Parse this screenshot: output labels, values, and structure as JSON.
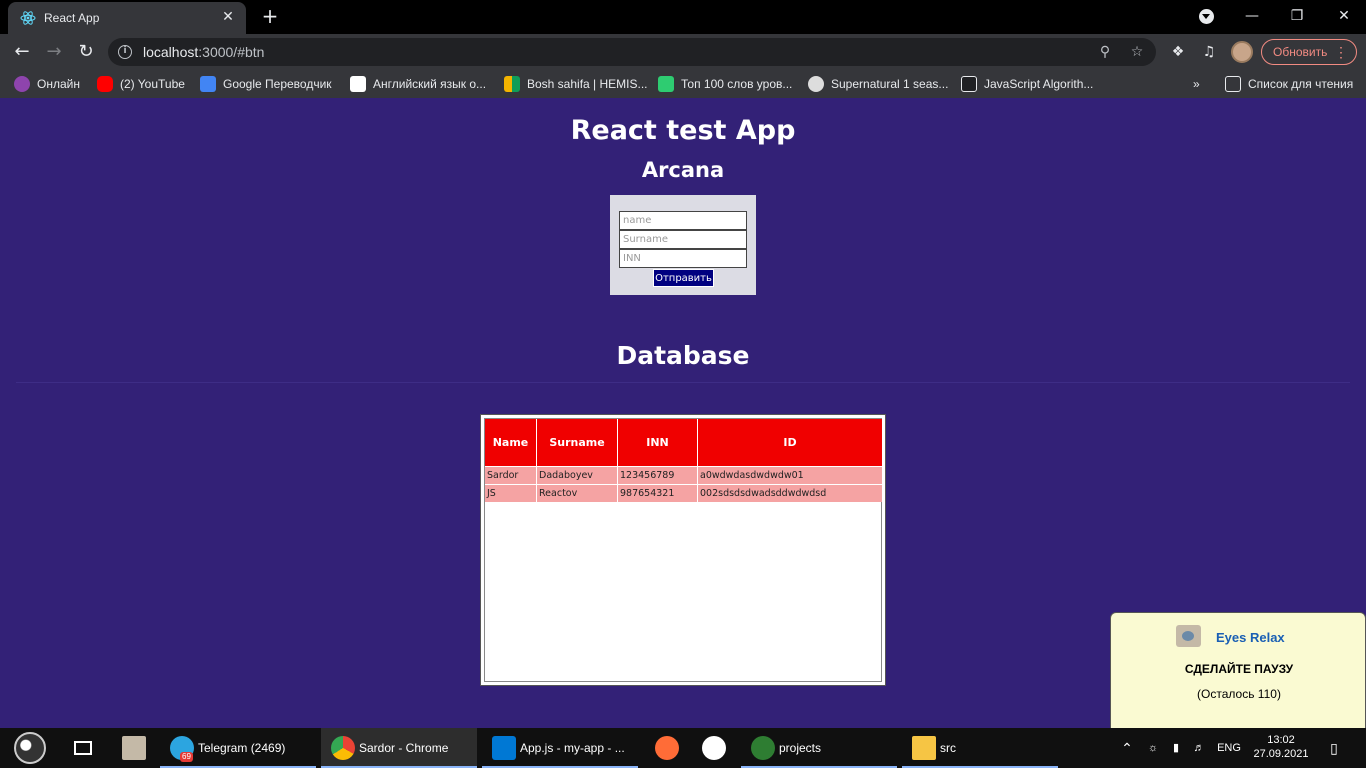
{
  "browser": {
    "tab_title": "React App",
    "url_host": "localhost",
    "url_rest": ":3000/#btn",
    "update_label": "Обновить",
    "bookmarks": [
      {
        "label": "Онлайн",
        "color": "#8e44ad"
      },
      {
        "label": "(2) YouTube",
        "color": "#ff0000"
      },
      {
        "label": "Google Переводчик",
        "color": "#4285f4"
      },
      {
        "label": "Английский язык о...",
        "color": "#ffffff"
      },
      {
        "label": "Bosh sahifa | HEMIS...",
        "color": "#f4b400"
      },
      {
        "label": "Топ 100 слов уров...",
        "color": "#2ecc71"
      },
      {
        "label": "Supernatural 1 seas...",
        "color": "#dddddd"
      },
      {
        "label": "JavaScript Algorith...",
        "color": "#202124"
      }
    ],
    "reading_list": "Список для чтения"
  },
  "page": {
    "title": "React test App",
    "subtitle": "Arcana",
    "form": {
      "name_placeholder": "name",
      "surname_placeholder": "Surname",
      "inn_placeholder": "INN",
      "submit_label": "Отправить"
    },
    "db_title": "Database",
    "table": {
      "headers": [
        "Name",
        "Surname",
        "INN",
        "ID"
      ],
      "rows": [
        [
          "Sardor",
          "Dadaboyev",
          "123456789",
          "a0wdwdasdwdwdw01"
        ],
        [
          "JS",
          "Reactov",
          "987654321",
          "002sdsdsdwadsddwdwdsd"
        ]
      ]
    }
  },
  "notification": {
    "app": "Eyes Relax",
    "message": "СДЕЛАЙТЕ ПАУЗУ",
    "remaining": "(Осталось 110)"
  },
  "taskbar": {
    "telegram": "Telegram (2469)",
    "telegram_badge": "69",
    "chrome": "Sardor - Chrome",
    "vscode": "App.js - my-app - ...",
    "projects": "projects",
    "src": "src",
    "lang": "ENG",
    "time": "13:02",
    "date": "27.09.2021"
  }
}
